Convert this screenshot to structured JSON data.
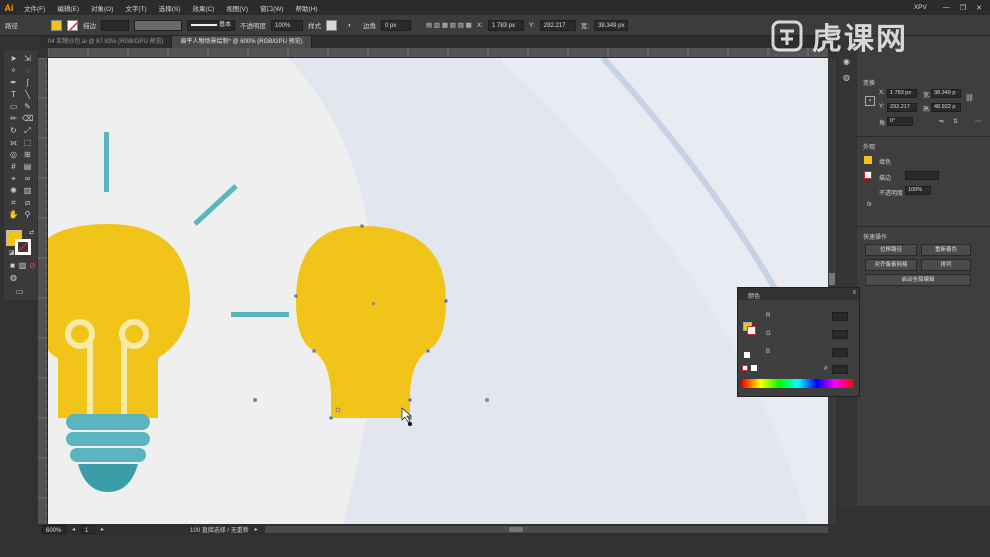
{
  "app": {
    "logo": "Ai"
  },
  "menubar": {
    "items": [
      "文件(F)",
      "编辑(E)",
      "对象(O)",
      "文字(T)",
      "选择(S)",
      "效果(C)",
      "视图(V)",
      "窗口(W)",
      "帮助(H)"
    ],
    "workspace": "XPV",
    "window_controls": [
      "—",
      "❐",
      "✕"
    ]
  },
  "controlbar": {
    "selection_label": "路径",
    "stroke_label": "描边",
    "stroke_profile": "基本",
    "opacity_label": "不透明度",
    "opacity_value": "100%",
    "style_label": "样式",
    "corner_label": "边角",
    "corner_value": "0 px",
    "x_label": "X:",
    "x_value": "1 783 px",
    "y_label": "Y:",
    "y_value": "292.217",
    "w_label": "宽:",
    "w_value": "38.349 px",
    "h_label": "高:",
    "h_value": "48.922 px",
    "fill_color": "#f0c419"
  },
  "tabs": [
    {
      "label": "04 实物沙包.ai @ 87.83% (RGB/GPU 预览)",
      "active": false
    },
    {
      "label": "扁平人物场景绘制* @ 600% (RGB/GPU 预览)",
      "active": true
    }
  ],
  "statusbar": {
    "zoom": "600%",
    "page": "1",
    "tool": "直接选择",
    "status_text": "100 直接选择 / 无重新"
  },
  "transform_panel": {
    "title": "变换",
    "x_label": "X:",
    "x_value": "1 783 px",
    "y_label": "Y:",
    "y_value": "292.217",
    "w_label": "宽:",
    "w_value": "38.349 p",
    "h_label": "高:",
    "h_value": "48.922 p",
    "angle_label": "角:",
    "angle_value": "0°"
  },
  "appearance_panel": {
    "title": "外观",
    "fill_label": "填色",
    "stroke_label": "描边",
    "opacity_label": "不透明度",
    "opacity_value": "100%",
    "fx": "fx"
  },
  "quick_actions": {
    "title": "快速操作",
    "buttons": [
      "位移路径",
      "重新着色",
      "对齐像素网格",
      "排列"
    ],
    "dropdown": "启动全局编辑"
  },
  "color_panel": {
    "title": "颜色",
    "r_label": "R",
    "g_label": "G",
    "b_label": "B",
    "hex_label": "#"
  },
  "watermark": {
    "text": "虎课网"
  },
  "colors": {
    "bulb_yellow": "#f0c419",
    "teal": "#5bb5bf",
    "teal_dark": "#3a9ea8",
    "canvas_bg": "#efefef",
    "light_blue": "#e2e6ef",
    "stroke_line": "#c8d2e6"
  }
}
